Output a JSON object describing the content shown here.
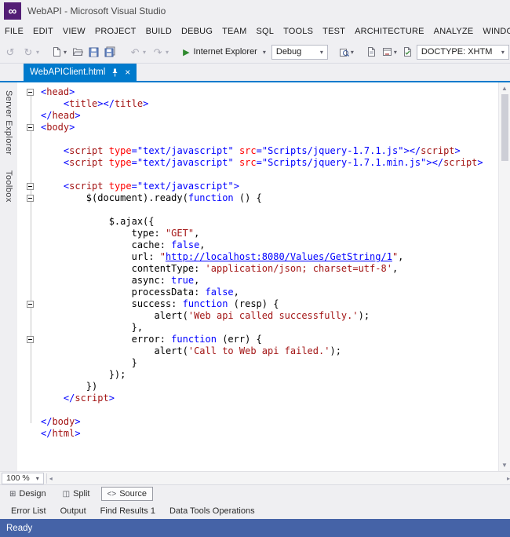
{
  "window": {
    "title": "WebAPI - Microsoft Visual Studio"
  },
  "menu": {
    "items": [
      "FILE",
      "EDIT",
      "VIEW",
      "PROJECT",
      "BUILD",
      "DEBUG",
      "TEAM",
      "SQL",
      "TOOLS",
      "TEST",
      "ARCHITECTURE",
      "ANALYZE",
      "WINDOW"
    ]
  },
  "toolbar": {
    "run_target_label": "Internet Explorer",
    "config_value": "Debug",
    "doctype_value": "DOCTYPE: XHTM"
  },
  "icons": {
    "infinity": "∞",
    "dropdown": "▾",
    "play": "▶",
    "back": "↺",
    "forward": "↻",
    "undo": "↶",
    "redo": "↷",
    "close": "×",
    "scroll_up": "▲",
    "scroll_down": "▼",
    "scroll_left": "◂",
    "scroll_right": "▸"
  },
  "side_strip": {
    "items": [
      "Server Explorer",
      "Toolbox"
    ]
  },
  "tabs": [
    {
      "label": "WebAPIClient.html",
      "active": true
    }
  ],
  "editor": {
    "code_lines": [
      {
        "fold": true,
        "tokens": [
          [
            "d",
            "<"
          ],
          [
            "t",
            "head"
          ],
          [
            "d",
            ">"
          ]
        ]
      },
      {
        "tokens": [
          [
            "p",
            "    "
          ],
          [
            "d",
            "<"
          ],
          [
            "t",
            "title"
          ],
          [
            "d",
            "></"
          ],
          [
            "t",
            "title"
          ],
          [
            "d",
            ">"
          ]
        ]
      },
      {
        "tokens": [
          [
            "d",
            "</"
          ],
          [
            "t",
            "head"
          ],
          [
            "d",
            ">"
          ]
        ]
      },
      {
        "fold": true,
        "tokens": [
          [
            "d",
            "<"
          ],
          [
            "t",
            "body"
          ],
          [
            "d",
            ">"
          ]
        ]
      },
      {
        "tokens": []
      },
      {
        "tokens": [
          [
            "p",
            "    "
          ],
          [
            "d",
            "<"
          ],
          [
            "t",
            "script"
          ],
          [
            "p",
            " "
          ],
          [
            "a",
            "type"
          ],
          [
            "d",
            "="
          ],
          [
            "v",
            "\"text/javascript\""
          ],
          [
            "p",
            " "
          ],
          [
            "a",
            "src"
          ],
          [
            "d",
            "="
          ],
          [
            "v",
            "\"Scripts/jquery-1.7.1.js\""
          ],
          [
            "d",
            "></"
          ],
          [
            "t",
            "script"
          ],
          [
            "d",
            ">"
          ]
        ]
      },
      {
        "tokens": [
          [
            "p",
            "    "
          ],
          [
            "d",
            "<"
          ],
          [
            "t",
            "script"
          ],
          [
            "p",
            " "
          ],
          [
            "a",
            "type"
          ],
          [
            "d",
            "="
          ],
          [
            "v",
            "\"text/javascript\""
          ],
          [
            "p",
            " "
          ],
          [
            "a",
            "src"
          ],
          [
            "d",
            "="
          ],
          [
            "v",
            "\"Scripts/jquery-1.7.1.min.js\""
          ],
          [
            "d",
            "></"
          ],
          [
            "t",
            "script"
          ],
          [
            "d",
            ">"
          ]
        ]
      },
      {
        "tokens": []
      },
      {
        "fold": true,
        "tokens": [
          [
            "p",
            "    "
          ],
          [
            "d",
            "<"
          ],
          [
            "t",
            "script"
          ],
          [
            "p",
            " "
          ],
          [
            "a",
            "type"
          ],
          [
            "d",
            "="
          ],
          [
            "v",
            "\"text/javascript\""
          ],
          [
            "d",
            ">"
          ]
        ]
      },
      {
        "fold": true,
        "tokens": [
          [
            "p",
            "        $(document).ready("
          ],
          [
            "k",
            "function"
          ],
          [
            "p",
            " () {"
          ]
        ]
      },
      {
        "tokens": []
      },
      {
        "tokens": [
          [
            "p",
            "            $.ajax({"
          ]
        ]
      },
      {
        "tokens": [
          [
            "p",
            "                type: "
          ],
          [
            "s",
            "\"GET\""
          ],
          [
            "p",
            ","
          ]
        ]
      },
      {
        "tokens": [
          [
            "p",
            "                cache: "
          ],
          [
            "k",
            "false"
          ],
          [
            "p",
            ","
          ]
        ]
      },
      {
        "tokens": [
          [
            "p",
            "                url: "
          ],
          [
            "s",
            "\""
          ],
          [
            "u",
            "http://localhost:8080/Values/GetString/1"
          ],
          [
            "s",
            "\""
          ],
          [
            "p",
            ","
          ]
        ]
      },
      {
        "tokens": [
          [
            "p",
            "                contentType: "
          ],
          [
            "s",
            "'application/json; charset=utf-8'"
          ],
          [
            "p",
            ","
          ]
        ]
      },
      {
        "tokens": [
          [
            "p",
            "                async: "
          ],
          [
            "k",
            "true"
          ],
          [
            "p",
            ","
          ]
        ]
      },
      {
        "tokens": [
          [
            "p",
            "                processData: "
          ],
          [
            "k",
            "false"
          ],
          [
            "p",
            ","
          ]
        ]
      },
      {
        "fold": true,
        "tokens": [
          [
            "p",
            "                success: "
          ],
          [
            "k",
            "function"
          ],
          [
            "p",
            " (resp) {"
          ]
        ]
      },
      {
        "tokens": [
          [
            "p",
            "                    alert("
          ],
          [
            "s",
            "'Web api called successfully.'"
          ],
          [
            "p",
            ");"
          ]
        ]
      },
      {
        "tokens": [
          [
            "p",
            "                },"
          ]
        ]
      },
      {
        "fold": true,
        "tokens": [
          [
            "p",
            "                error: "
          ],
          [
            "k",
            "function"
          ],
          [
            "p",
            " (err) {"
          ]
        ]
      },
      {
        "tokens": [
          [
            "p",
            "                    alert("
          ],
          [
            "s",
            "'Call to Web api failed.'"
          ],
          [
            "p",
            ");"
          ]
        ]
      },
      {
        "tokens": [
          [
            "p",
            "                }"
          ]
        ]
      },
      {
        "tokens": [
          [
            "p",
            "            });"
          ]
        ]
      },
      {
        "tokens": [
          [
            "p",
            "        })"
          ]
        ]
      },
      {
        "tokens": [
          [
            "p",
            "    "
          ],
          [
            "d",
            "</"
          ],
          [
            "t",
            "script"
          ],
          [
            "d",
            ">"
          ]
        ]
      },
      {
        "tokens": []
      },
      {
        "tokens": [
          [
            "d",
            "</"
          ],
          [
            "t",
            "body"
          ],
          [
            "d",
            ">"
          ]
        ]
      },
      {
        "tokens": [
          [
            "d",
            "</"
          ],
          [
            "t",
            "html"
          ],
          [
            "d",
            ">"
          ]
        ]
      }
    ]
  },
  "editor_footer": {
    "zoom_value": "100 %",
    "views": [
      {
        "label": "Design",
        "icon": "⊞"
      },
      {
        "label": "Split",
        "icon": "◫"
      },
      {
        "label": "Source",
        "icon": "<>"
      }
    ],
    "active_view": "Source"
  },
  "bottom_panel": {
    "tabs": [
      "Error List",
      "Output",
      "Find Results 1",
      "Data Tools Operations"
    ]
  },
  "status_bar": {
    "text": "Ready"
  },
  "colors": {
    "accent": "#007ACC",
    "status_bar": "#4563A7",
    "logo": "#531E75",
    "syntax": {
      "tag": "#A31515",
      "delimiter": "#0000FF",
      "attribute": "#FF0000",
      "value": "#0000FF",
      "keyword": "#0000FF",
      "string": "#A31515",
      "url": "#0000FF",
      "plain": "#000000"
    }
  }
}
